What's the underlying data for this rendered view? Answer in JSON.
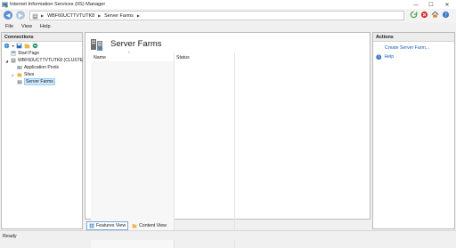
{
  "window": {
    "title": "Internet Information Services (IIS) Manager",
    "controls": {
      "minimize": "—",
      "maximize": "☐",
      "close": "✕"
    }
  },
  "address": {
    "crumbs": [
      "WBF60UCTTVTUTK8",
      "Server Farms"
    ]
  },
  "menu": [
    "File",
    "View",
    "Help"
  ],
  "connections": {
    "title": "Connections",
    "tree": [
      {
        "label": "Start Page"
      },
      {
        "label": "WBF60UCTTVTUTK8 (CLUSTE"
      },
      {
        "label": "Application Pools"
      },
      {
        "label": "Sites"
      },
      {
        "label": "Server Farms"
      }
    ]
  },
  "main": {
    "title": "Server Farms",
    "columns": [
      "Name",
      "Status"
    ],
    "sort_indicator": "^"
  },
  "view_tabs": [
    "Features View",
    "Content View"
  ],
  "actions": {
    "title": "Actions",
    "items": [
      {
        "label": "Create Server Farm..."
      },
      {
        "label": "Help"
      }
    ]
  },
  "status": "Ready"
}
